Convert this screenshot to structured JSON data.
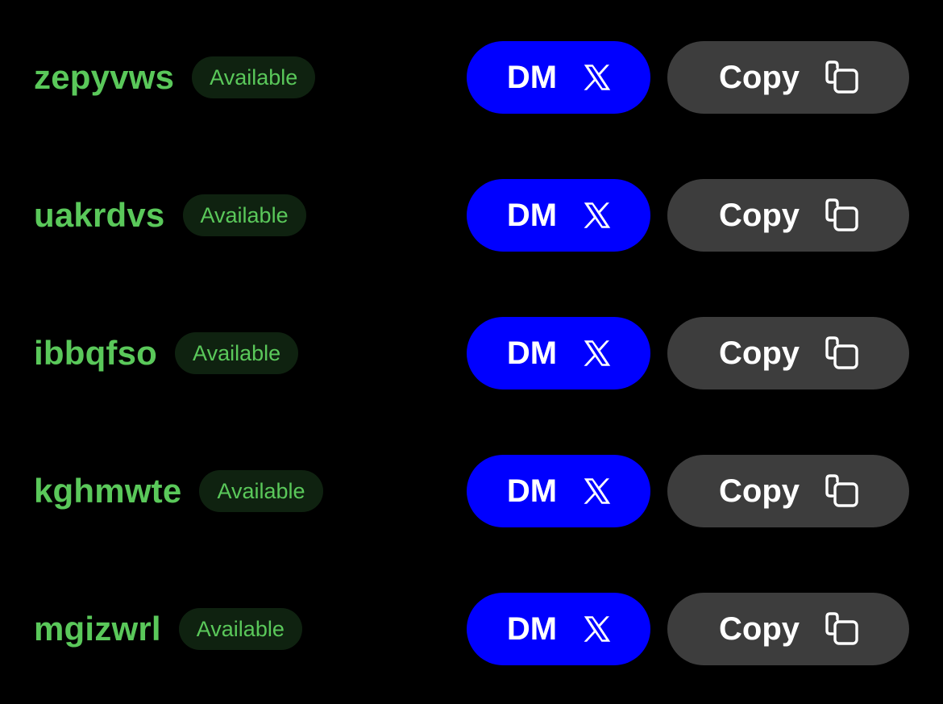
{
  "rows": [
    {
      "username": "zepyvws",
      "status": "Available",
      "dm_label": "DM",
      "copy_label": "Copy"
    },
    {
      "username": "uakrdvs",
      "status": "Available",
      "dm_label": "DM",
      "copy_label": "Copy"
    },
    {
      "username": "ibbqfso",
      "status": "Available",
      "dm_label": "DM",
      "copy_label": "Copy"
    },
    {
      "username": "kghmwte",
      "status": "Available",
      "dm_label": "DM",
      "copy_label": "Copy"
    },
    {
      "username": "mgizwrl",
      "status": "Available",
      "dm_label": "DM",
      "copy_label": "Copy"
    }
  ],
  "icons": {
    "dm": "x-logo-icon",
    "copy": "copy-icon"
  },
  "colors": {
    "background": "#000000",
    "username": "#5ac85a",
    "badge_background": "#0f2210",
    "badge_text": "#5ac85a",
    "dm_button": "#0000ff",
    "copy_button": "#3d3d3d",
    "button_text": "#ffffff"
  }
}
